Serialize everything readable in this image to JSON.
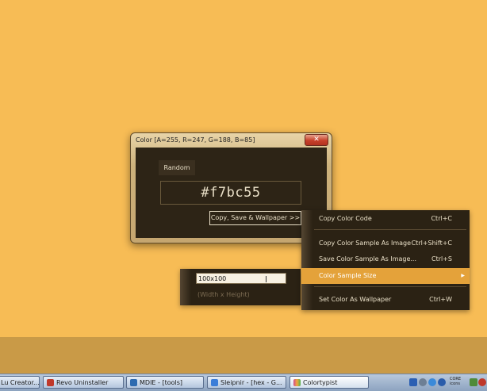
{
  "window": {
    "title": "Color [A=255, R=247, G=188, B=85]",
    "close_glyph": "✕",
    "random_label": "Random",
    "hex_value": "#f7bc55",
    "copy_button_label": "Copy, Save & Wallpaper >>",
    "color": "#f7bc55"
  },
  "size_panel": {
    "input_value": "100x100",
    "hint": "(Width x Height)"
  },
  "menu": {
    "items": [
      {
        "label": "Copy Color Code",
        "shortcut": "Ctrl+C"
      },
      {
        "label": "Copy Color Sample As Image",
        "shortcut": "Ctrl+Shift+C"
      },
      {
        "label": "Save Color Sample As Image...",
        "shortcut": "Ctrl+S"
      },
      {
        "label": "Color Sample Size",
        "shortcut": "",
        "submenu_arrow": "▶",
        "highlighted": true
      },
      {
        "label": "Set Color As Wallpaper",
        "shortcut": "Ctrl+W"
      }
    ]
  },
  "taskbar": {
    "items": [
      {
        "label": "Lu Creator...",
        "icon_color": "#3a6fc4"
      },
      {
        "label": "Revo Uninstaller",
        "icon_color": "#c0392b"
      },
      {
        "label": "MDIE - [tools]",
        "icon_color": "#2e6bb0"
      },
      {
        "label": "Sleipnir - [hex - G...",
        "icon_color": "#3b7dd8"
      },
      {
        "label": "Colortypist",
        "icon_color": "#d14b8f",
        "active": true
      }
    ],
    "tray": {
      "clock_line1": "CORE",
      "clock_line2": "icons"
    }
  },
  "colors": {
    "desktop": "#f7bc55",
    "panel_dark": "#2d2416",
    "menu_highlight": "#e4a23a"
  }
}
